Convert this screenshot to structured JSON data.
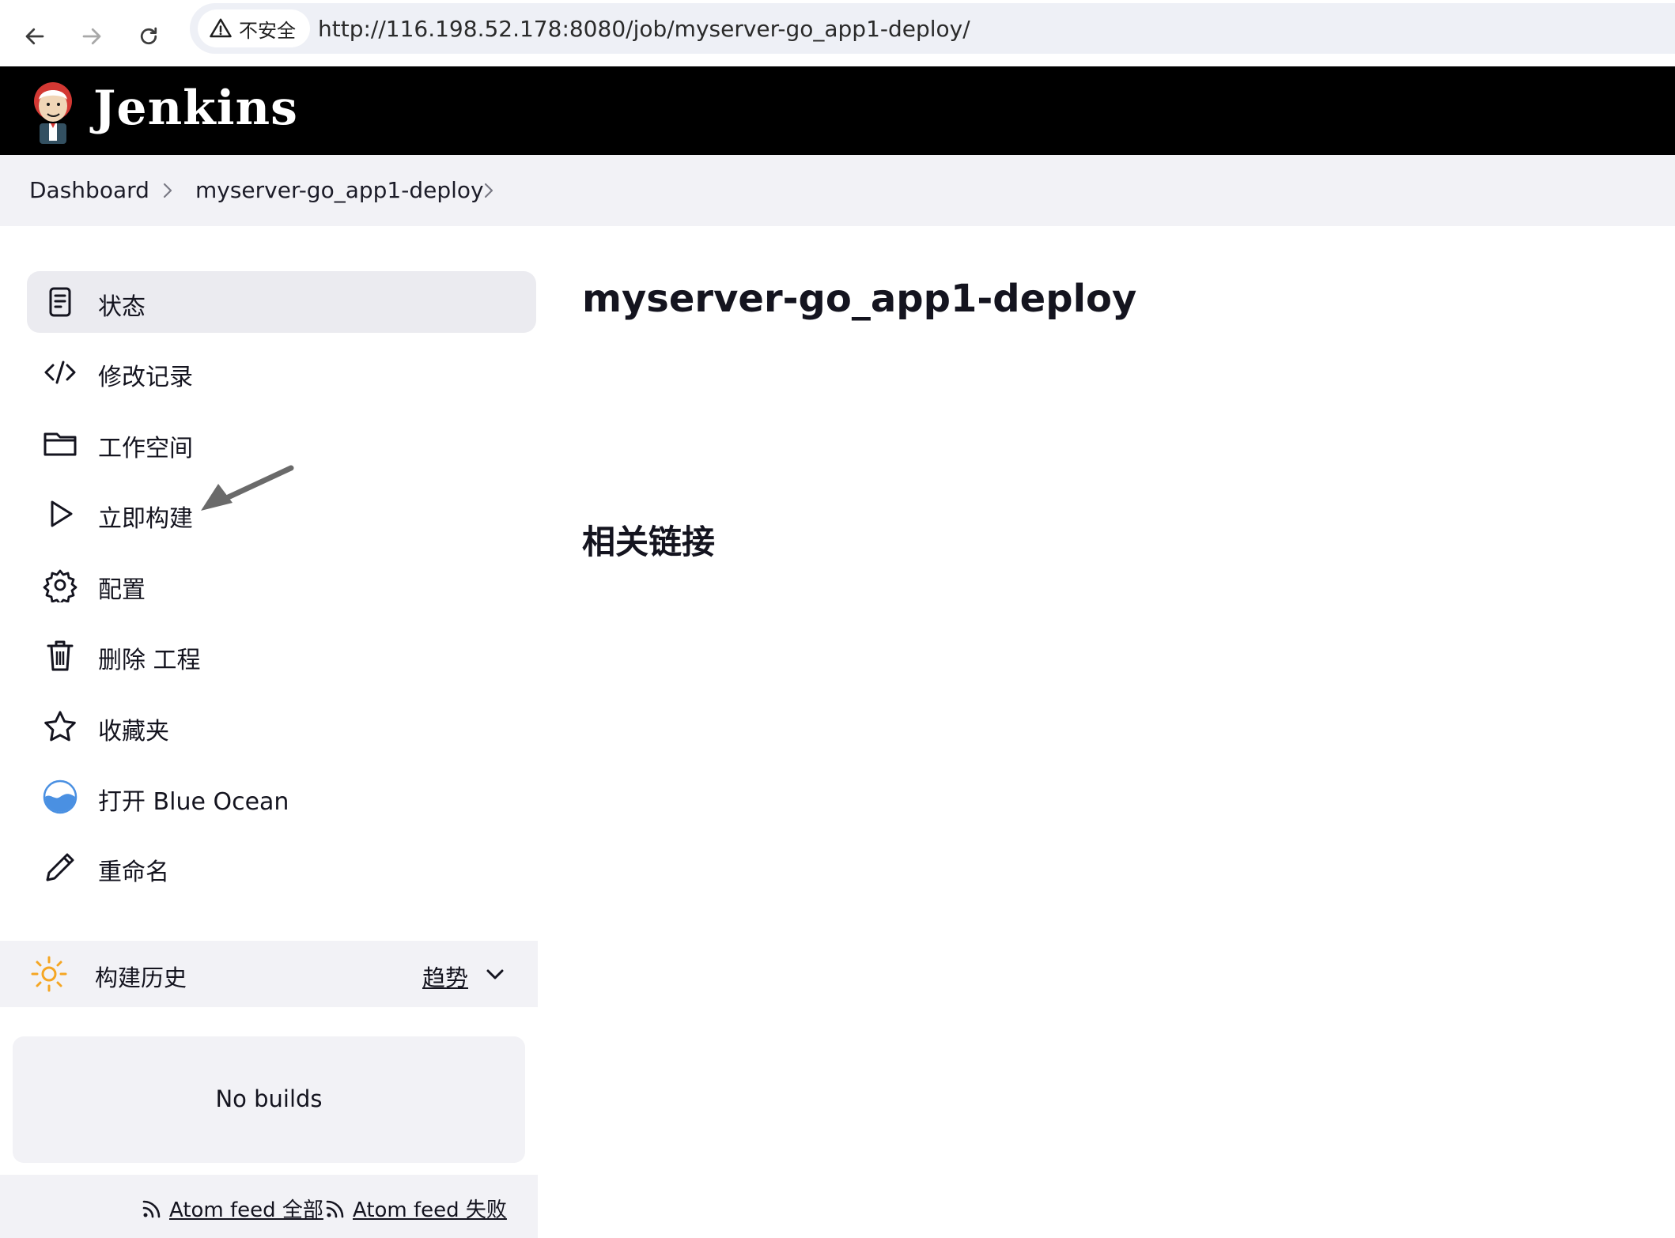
{
  "browser": {
    "security_label": "不安全",
    "url": "http://116.198.52.178:8080/job/myserver-go_app1-deploy/"
  },
  "header": {
    "brand": "Jenkins"
  },
  "breadcrumb": [
    {
      "label": "Dashboard"
    },
    {
      "label": "myserver-go_app1-deploy"
    }
  ],
  "sidebar": {
    "items": [
      {
        "label": "状态",
        "icon": "status-document-icon",
        "active": true
      },
      {
        "label": "修改记录",
        "icon": "code-icon"
      },
      {
        "label": "工作空间",
        "icon": "folder-icon"
      },
      {
        "label": "立即构建",
        "icon": "play-icon"
      },
      {
        "label": "配置",
        "icon": "gear-icon"
      },
      {
        "label": "删除 工程",
        "icon": "trash-icon"
      },
      {
        "label": "收藏夹",
        "icon": "star-icon"
      },
      {
        "label": "打开 Blue Ocean",
        "icon": "blue-ocean-icon"
      },
      {
        "label": "重命名",
        "icon": "pencil-icon"
      }
    ]
  },
  "build_history": {
    "title": "构建历史",
    "trend": "趋势",
    "empty": "No builds",
    "feeds": [
      {
        "label": "Atom feed 全部"
      },
      {
        "label": "Atom feed 失败"
      }
    ]
  },
  "main": {
    "title": "myserver-go_app1-deploy",
    "related_links": "相关链接"
  },
  "colors": {
    "header_bg": "#000000",
    "breadcrumb_bg": "#f2f2f6",
    "active_item_bg": "#ebebf0",
    "sun_icon": "#f5a623",
    "blue_ocean": "#4a90e2"
  }
}
